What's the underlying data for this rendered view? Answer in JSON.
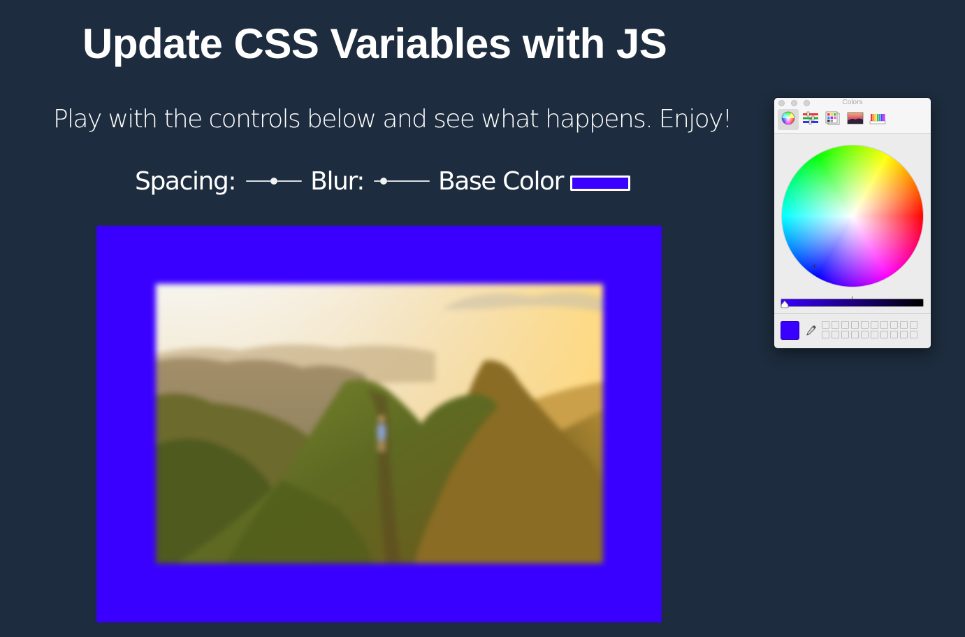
{
  "page": {
    "title": "Update CSS Variables with JS",
    "subtitle": "Play with the controls below and see what happens. Enjoy!",
    "background_color": "#1d2c3e"
  },
  "controls": {
    "spacing_label": "Spacing:",
    "spacing_value_fraction": 0.5,
    "blur_label": "Blur:",
    "blur_value_fraction": 0.18,
    "base_color_label": "Base Color",
    "base_color_value": "#3a00ff"
  },
  "preview": {
    "frame_color": "#3a00ff",
    "photo_subject": "mountain-ridge-hiker-photo"
  },
  "colors_panel": {
    "title": "Colors",
    "modes": [
      {
        "name": "color-wheel-icon",
        "active": true
      },
      {
        "name": "color-sliders-icon",
        "active": false
      },
      {
        "name": "color-palettes-icon",
        "active": false
      },
      {
        "name": "image-palettes-icon",
        "active": false
      },
      {
        "name": "pencils-icon",
        "active": false
      }
    ],
    "current_color": "#3a00ff",
    "brightness_fraction": 0.0,
    "saved_swatch_count": 20
  }
}
